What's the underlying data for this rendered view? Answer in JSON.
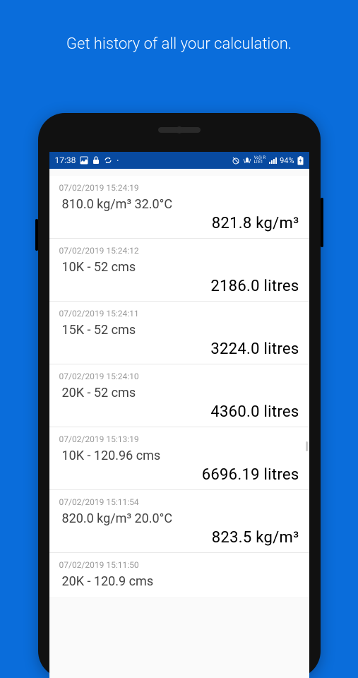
{
  "headline": "Get history of all your calculation.",
  "status": {
    "time": "17:38",
    "battery": "94%"
  },
  "history": [
    {
      "ts": "07/02/2019 15:24:19",
      "input": "810.0 kg/m³ 32.0°C",
      "result": "821.8 kg/m³"
    },
    {
      "ts": "07/02/2019 15:24:12",
      "input": "10K - 52 cms",
      "result": "2186.0 litres"
    },
    {
      "ts": "07/02/2019 15:24:11",
      "input": "15K - 52 cms",
      "result": "3224.0 litres"
    },
    {
      "ts": "07/02/2019 15:24:10",
      "input": "20K - 52 cms",
      "result": "4360.0 litres"
    },
    {
      "ts": "07/02/2019 15:13:19",
      "input": "10K - 120.96 cms",
      "result": "6696.19 litres"
    },
    {
      "ts": "07/02/2019 15:11:54",
      "input": "820.0 kg/m³ 20.0°C",
      "result": "823.5 kg/m³"
    },
    {
      "ts": "07/02/2019 15:11:50",
      "input": "20K - 120.9 cms",
      "result": ""
    }
  ]
}
